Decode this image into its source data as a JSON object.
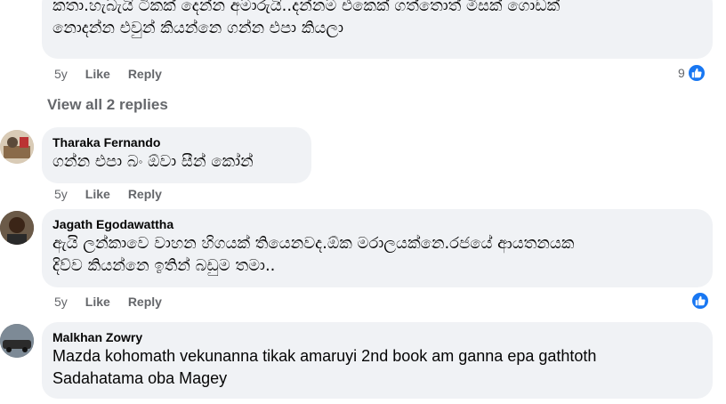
{
  "comment_top": {
    "text_line0": "...",
    "text_line1": "කතා.හැබැයි ටිකක් දෙන්න අමාරුයි..දන්නම එකෙක් ගත්තොත් මිසක් ගොඩක්",
    "text_line2": "නොදන්න එවුන් කියන්නෙ ගන්න එපා කියලා",
    "age": "5y",
    "like_label": "Like",
    "reply_label": "Reply",
    "reaction_count": "9"
  },
  "view_replies": "View all 2 replies",
  "comments": [
    {
      "author": "Tharaka Fernando",
      "text": "ගන්න එපා බං ඕවා සීන් කෝන්",
      "age": "5y",
      "like_label": "Like",
      "reply_label": "Reply"
    },
    {
      "author": "Jagath Egodawattha",
      "text_line1": "ඇයි ලන්කාවෙ වාහන හිගයක් තියෙනවද.ඕක මරාලයක්නෙ.රජයේ ආයතනයක",
      "text_line2": "දිව්ව කියන්නෙ ඉතින් බඩුම තමා..",
      "age": "5y",
      "like_label": "Like",
      "reply_label": "Reply"
    },
    {
      "author": "Malkhan Zowry",
      "text_line1": "Mazda kohomath vekunanna tikak amaruyi 2nd book am ganna epa gathtoth",
      "text_line2": "Sadahatama oba Magey"
    }
  ],
  "colors": {
    "bubble": "#f0f2f5",
    "meta": "#65676b",
    "like_blue": "#1877f2"
  },
  "icons": {
    "reaction": "like-thumb-icon"
  }
}
